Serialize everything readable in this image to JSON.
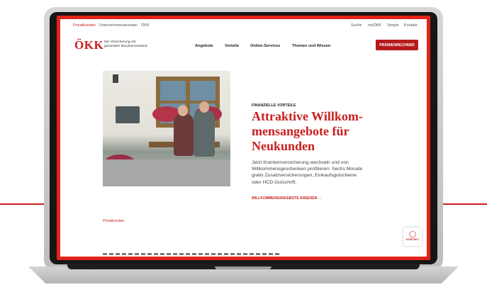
{
  "top_nav": {
    "left": [
      "Privatkunden",
      "Unternehmenskunden",
      "ÖKK"
    ],
    "right": [
      "Suche",
      "myÖKK",
      "Simple",
      "Kontakt"
    ]
  },
  "header": {
    "logo": "ÖKK",
    "tagline_line1": "Die Versicherung mit",
    "tagline_line2": "gesundem Bündnerverstand.",
    "main_nav": [
      "Angebote",
      "Vorteile",
      "Online-Services",
      "Themen und Wissen"
    ],
    "cta_label": "PRÄMIENRECHNER"
  },
  "hero": {
    "eyebrow": "FINANZIELLE VORTEILE",
    "headline_lines": [
      "Attraktive Willkom-",
      "mensangebote für",
      "Neukunden"
    ],
    "body_lines": [
      "Jetzt Krankenversicherung wechseln und von",
      "Willkommensgeschenken profitieren: Sechs Monate",
      "gratis Zusatzversicherungen, Einkaufsgutscheine",
      "oder HCD-Gutschrift."
    ],
    "link_label": "WILLKOMMENSANGEBOTE ANSEHEN →"
  },
  "breadcrumb": "Privatkunden",
  "kontakt": {
    "label": "KONTAKT",
    "icon": "person-icon"
  },
  "colors": {
    "accent": "#c8201f",
    "frame": "#e2231a"
  }
}
